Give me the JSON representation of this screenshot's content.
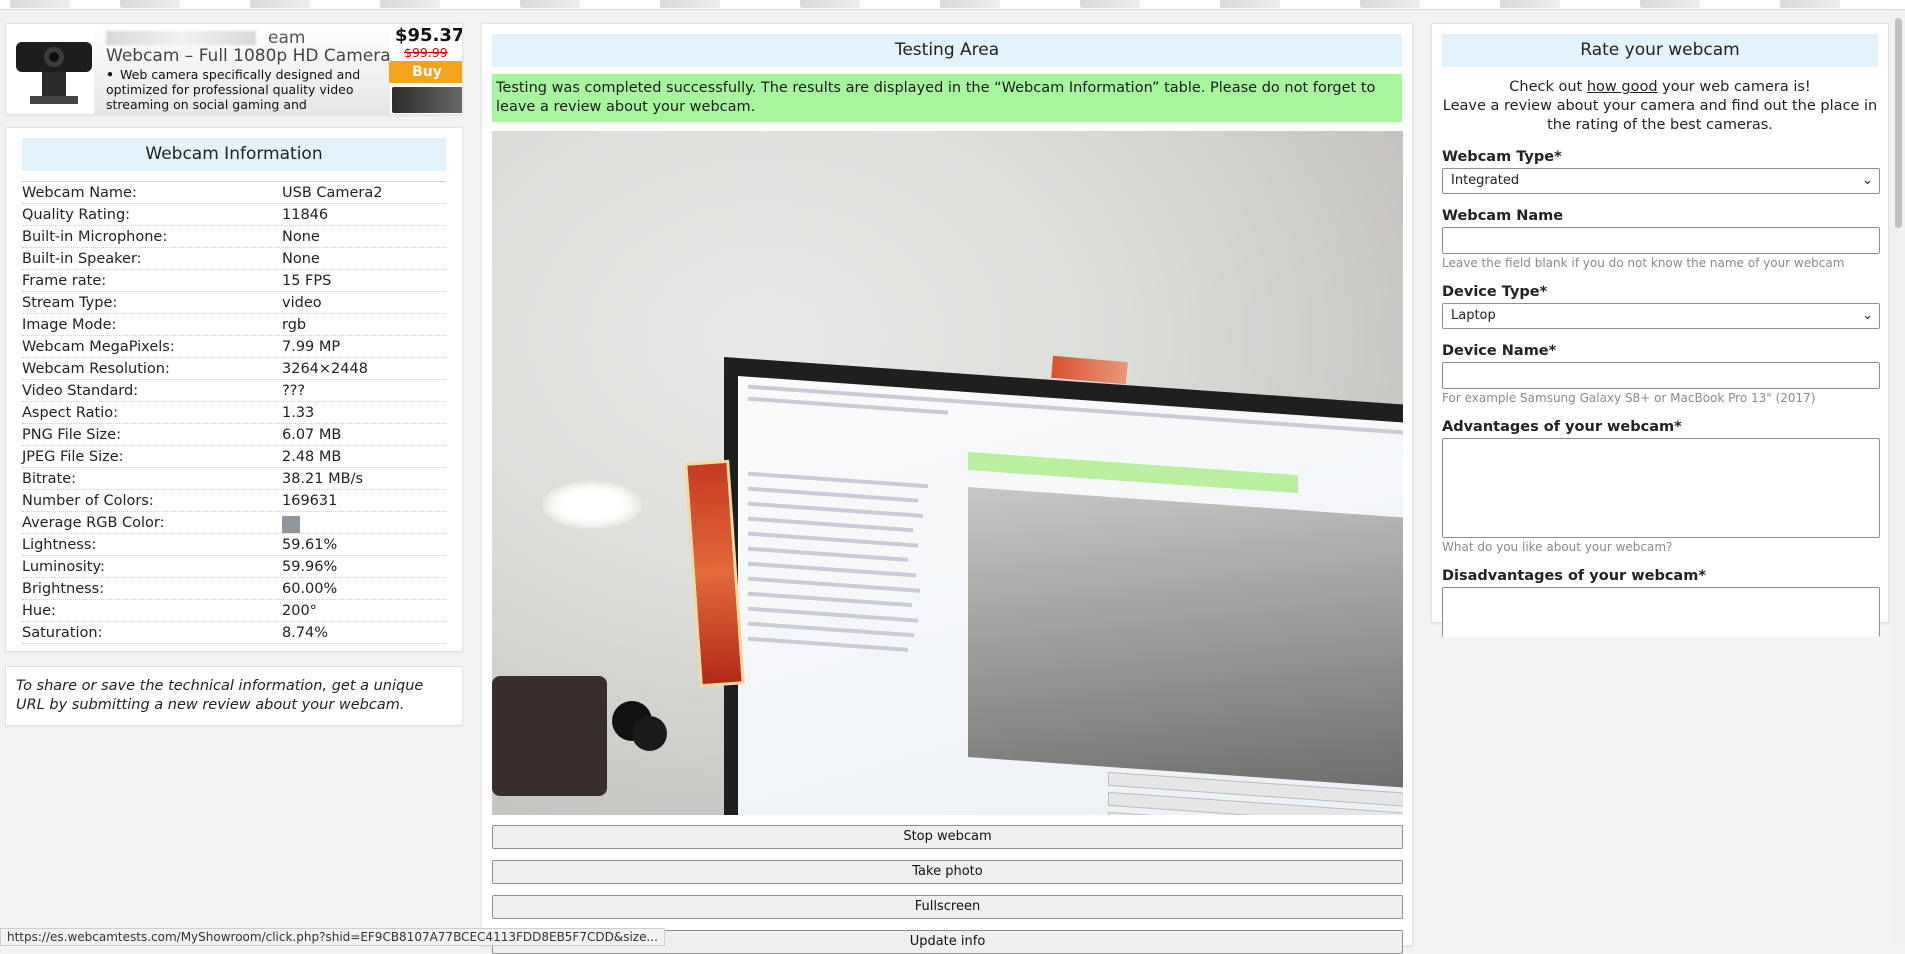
{
  "ad": {
    "title_tail": "eam",
    "subtitle": "Webcam – Full 1080p HD Camera",
    "bullet": "Web camera specifically designed and optimized for professional quality video streaming on social gaming and",
    "price": "$95.37",
    "old_price": "$99.99",
    "buy_label": "Buy"
  },
  "info": {
    "title": "Webcam Information",
    "rows": [
      {
        "k": "Webcam Name:",
        "v": "USB Camera2"
      },
      {
        "k": "Quality Rating:",
        "v": "11846"
      },
      {
        "k": "Built-in Microphone:",
        "v": "None"
      },
      {
        "k": "Built-in Speaker:",
        "v": "None"
      },
      {
        "k": "Frame rate:",
        "v": "15 FPS"
      },
      {
        "k": "Stream Type:",
        "v": "video"
      },
      {
        "k": "Image Mode:",
        "v": "rgb"
      },
      {
        "k": "Webcam MegaPixels:",
        "v": "7.99 MP"
      },
      {
        "k": "Webcam Resolution:",
        "v": "3264×2448"
      },
      {
        "k": "Video Standard:",
        "v": "???"
      },
      {
        "k": "Aspect Ratio:",
        "v": "1.33"
      },
      {
        "k": "PNG File Size:",
        "v": "6.07 MB"
      },
      {
        "k": "JPEG File Size:",
        "v": "2.48 MB"
      },
      {
        "k": "Bitrate:",
        "v": "38.21 MB/s"
      },
      {
        "k": "Number of Colors:",
        "v": "169631"
      },
      {
        "k": "Average RGB Color:",
        "v": ""
      },
      {
        "k": "Lightness:",
        "v": "59.61%"
      },
      {
        "k": "Luminosity:",
        "v": "59.96%"
      },
      {
        "k": "Brightness:",
        "v": "60.00%"
      },
      {
        "k": "Hue:",
        "v": "200°"
      },
      {
        "k": "Saturation:",
        "v": "8.74%"
      }
    ],
    "avg_color": "#8f979c"
  },
  "share": {
    "text": "To share or save the technical information, get a unique URL by submitting a new review about your webcam."
  },
  "testing": {
    "title": "Testing Area",
    "success": "Testing was completed successfully. The results are displayed in the “Webcam Information” table. Please do not forget to leave a review about your webcam.",
    "buttons": {
      "stop": "Stop webcam",
      "photo": "Take photo",
      "fullscreen": "Fullscreen",
      "update": "Update info"
    }
  },
  "rate": {
    "title": "Rate your webcam",
    "intro_pre": "Check out ",
    "intro_link": "how good",
    "intro_post": " your web camera is!",
    "intro_line2": "Leave a review about your camera and find out the place in the rating of the best cameras.",
    "webcam_type_label": "Webcam Type*",
    "webcam_type_value": "Integrated",
    "webcam_name_label": "Webcam Name",
    "webcam_name_hint": "Leave the field blank if you do not know the name of your webcam",
    "device_type_label": "Device Type*",
    "device_type_value": "Laptop",
    "device_name_label": "Device Name*",
    "device_name_hint": "For example Samsung Galaxy S8+ or MacBook Pro 13\" (2017)",
    "advantages_label": "Advantages of your webcam*",
    "advantages_hint": "What do you like about your webcam?",
    "disadvantages_label": "Disadvantages of your webcam*"
  },
  "status_url": "https://es.webcamtests.com/MyShowroom/click.php?shid=EF9CB8107A77BCEC4113FDD8EB5F7CDD&size...",
  "colors": {
    "header_bg": "#e3f3fb",
    "success_bg": "#a7f59d",
    "buy_bg": "#f4a51c",
    "old_price": "#cc0000"
  }
}
